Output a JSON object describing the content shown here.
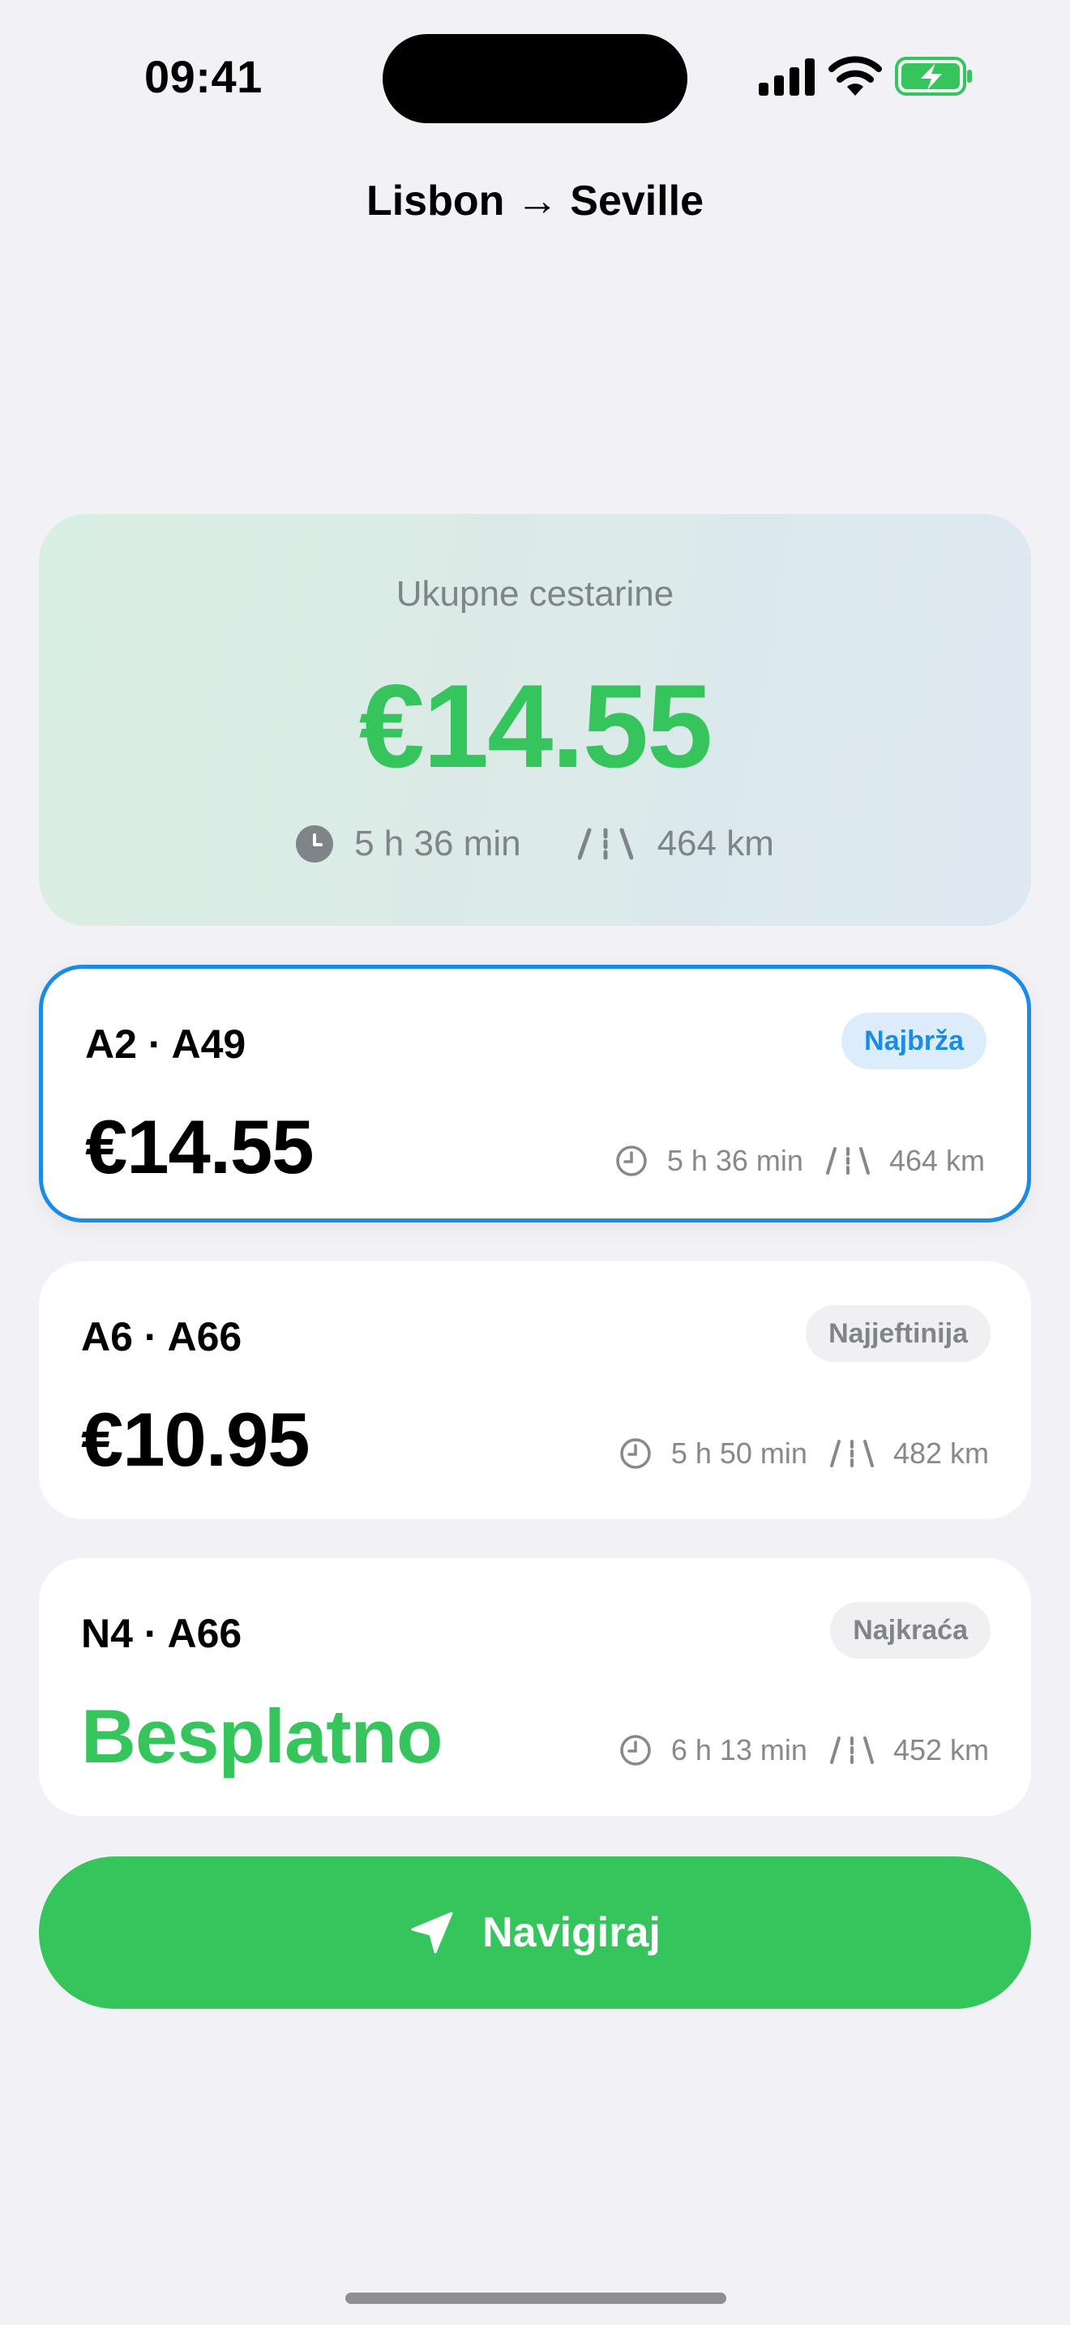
{
  "status_bar": {
    "time": "09:41"
  },
  "trip": {
    "title": "Lisbon → Seville"
  },
  "summary": {
    "label": "Ukupne cestarine",
    "amount": "€14.55",
    "duration": "5 h 36 min",
    "distance": "464 km"
  },
  "routes": [
    {
      "name": "A2 · A49",
      "badge": "Najbrža",
      "price": "€14.55",
      "duration": "5 h 36 min",
      "distance": "464 km",
      "selected": true
    },
    {
      "name": "A6 · A66",
      "badge": "Najjeftinija",
      "price": "€10.95",
      "duration": "5 h 50 min",
      "distance": "482 km",
      "selected": false
    },
    {
      "name": "N4 · A66",
      "badge": "Najkraća",
      "price": "Besplatno",
      "duration": "6 h 13 min",
      "distance": "452 km",
      "selected": false
    }
  ],
  "navigate": {
    "label": "Navigiraj"
  },
  "colors": {
    "accent_green": "#35c55c",
    "accent_blue": "#1a8be6",
    "background": "#f2f2f6"
  }
}
